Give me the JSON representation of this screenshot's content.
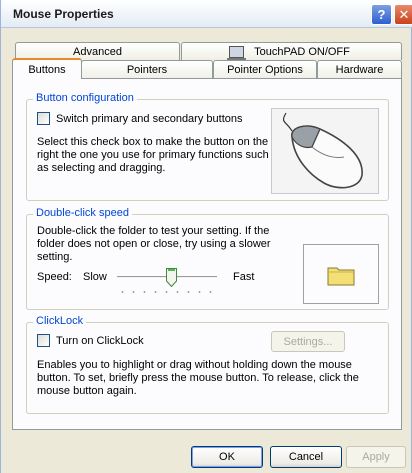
{
  "window": {
    "title": "Mouse Properties"
  },
  "tabs_back": [
    {
      "label": "Advanced"
    },
    {
      "label": "TouchPAD ON/OFF",
      "icon": "touchpad-icon"
    }
  ],
  "tabs_front": [
    {
      "label": "Buttons",
      "selected": true
    },
    {
      "label": "Pointers"
    },
    {
      "label": "Pointer Options"
    },
    {
      "label": "Hardware"
    }
  ],
  "button_config": {
    "title": "Button configuration",
    "checkbox_label": "Switch primary and secondary buttons",
    "checked": false,
    "description": [
      "Select this check box to make the button on the",
      "right the one you use for primary functions such",
      "as selecting and dragging."
    ]
  },
  "double_click": {
    "title": "Double-click speed",
    "description": [
      "Double-click the folder to test your setting. If the",
      "folder does not open or close, try using a slower",
      "setting."
    ],
    "speed_label": "Speed:",
    "slow_label": "Slow",
    "fast_label": "Fast",
    "slider_level": 0.55
  },
  "clicklock": {
    "title": "ClickLock",
    "checkbox_label": "Turn on ClickLock",
    "checked": false,
    "settings_label": "Settings...",
    "description": [
      "Enables you to highlight or drag without holding down the mouse",
      "button. To set, briefly press the mouse button. To release, click the",
      "mouse button again."
    ]
  },
  "footer": {
    "ok": "OK",
    "cancel": "Cancel",
    "apply": "Apply"
  },
  "colors": {
    "accent_tab": "#e68b2c",
    "group_title": "#0046d5"
  }
}
